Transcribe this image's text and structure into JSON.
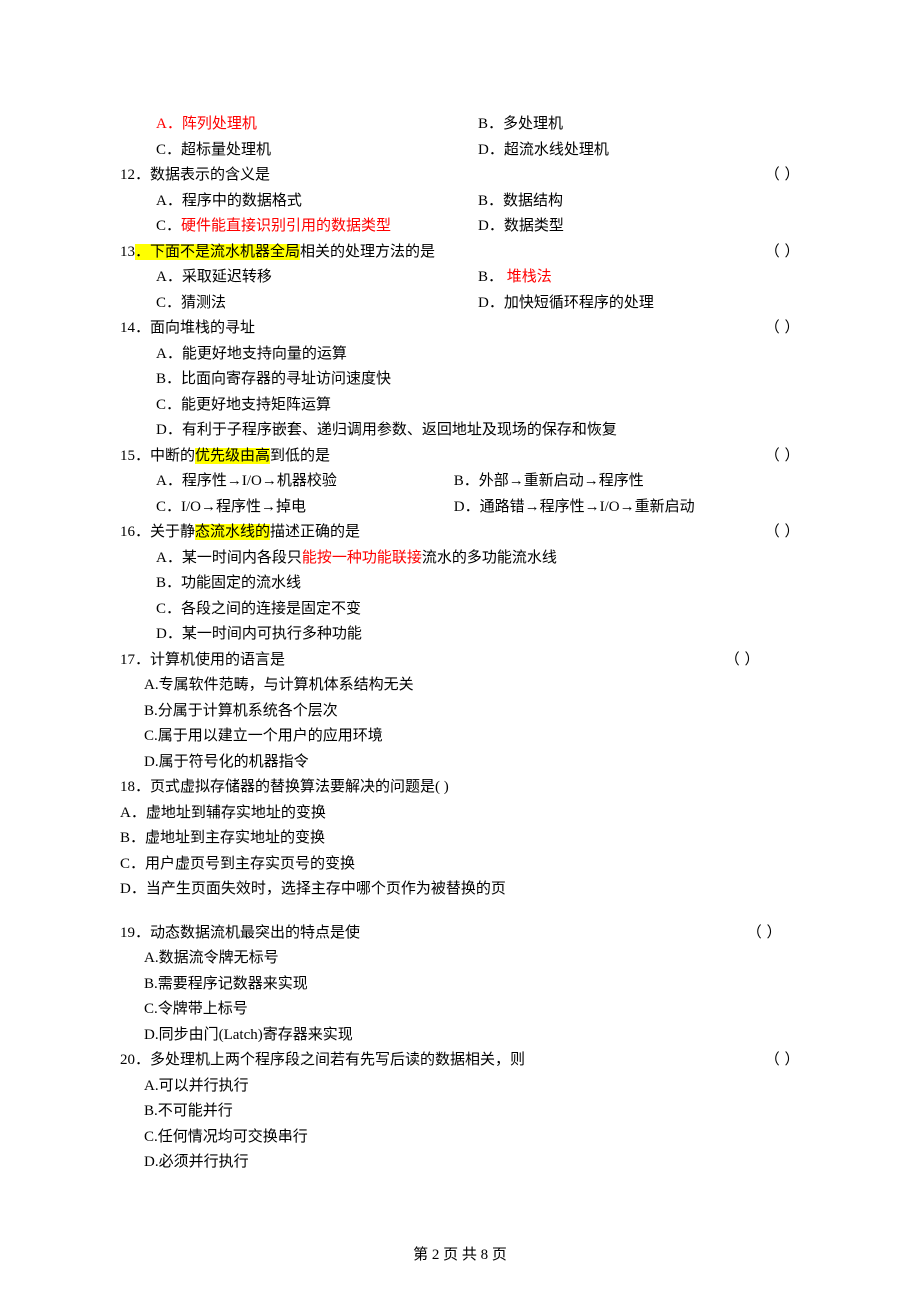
{
  "q11_opts": {
    "a": "A．阵列处理机",
    "b": "B．多处理机",
    "c": "C．超标量处理机",
    "d": "D．超流水线处理机"
  },
  "q12": {
    "stem_pre": "12．数据表示的含义是",
    "blank": "（         ）",
    "a": "A．程序中的数据格式",
    "b": "B．数据结构",
    "c_pre": "C．",
    "c_red": "硬件能直接识别引用的数据类型",
    "d": "D．数据类型"
  },
  "q13": {
    "num_pre": "13",
    "stem_hl": "．下面不是流水机器全局",
    "stem_post": "相关的处理方法的是",
    "blank": "（         ）",
    "a": "A．采取延迟转移",
    "b_pre": "B．    ",
    "b_red": "堆栈法",
    "c": "C．猜测法",
    "d": "D．加快短循环程序的处理"
  },
  "q14": {
    "stem": "14．面向堆栈的寻址",
    "blank": "（         ）",
    "a": "A．能更好地支持向量的运算",
    "b": "B．比面向寄存器的寻址访问速度快",
    "c": "C．能更好地支持矩阵运算",
    "d": "D．有利于子程序嵌套、递归调用参数、返回地址及现场的保存和恢复"
  },
  "q15": {
    "stem_pre": "15．中断的",
    "stem_hl": "优先级由高",
    "stem_post": "到低的是",
    "blank": "（         ）",
    "a": "A．程序性→I/O→机器校验",
    "b": "B．外部→重新启动→程序性",
    "c": "C．I/O→程序性→掉电",
    "d": "D．通路错→程序性→I/O→重新启动"
  },
  "q16": {
    "stem_pre": "16．关于静",
    "stem_hl": "态流水线的",
    "stem_post": "描述正确的是",
    "blank": "（         ）",
    "a_pre": "A．某一时间内各段只",
    "a_red": "能按一种功能联接",
    "a_post": "流水的多功能流水线",
    "b": "B．功能固定的流水线",
    "c": "C．各段之间的连接是固定不变",
    "d": "D．某一时间内可执行多种功能"
  },
  "q17": {
    "stem": "17．计算机使用的语言是",
    "blank": "（         ）",
    "a": "A.专属软件范畴，与计算机体系结构无关",
    "b": "B.分属于计算机系统各个层次",
    "c": "C.属于用以建立一个用户的应用环境",
    "d": "D.属于符号化的机器指令"
  },
  "q18": {
    "stem": "18．页式虚拟存储器的替换算法要解决的问题是(          )",
    "a": "A．虚地址到辅存实地址的变换",
    "b": "B．虚地址到主存实地址的变换",
    "c": "C．用户虚页号到主存实页号的变换",
    "d": "D．当产生页面失效时，选择主存中哪个页作为被替换的页"
  },
  "q19": {
    "stem": "19．动态数据流机最突出的特点是使",
    "blank": "（         ）",
    "a": "A.数据流令牌无标号",
    "b": "B.需要程序记数器来实现",
    "c": "C.令牌带上标号",
    "d": "D.同步由门(Latch)寄存器来实现"
  },
  "q20": {
    "stem": "20．多处理机上两个程序段之间若有先写后读的数据相关，则",
    "blank": "（         ）",
    "a": "A.可以并行执行",
    "b": "B.不可能并行",
    "c": "C.任何情况均可交换串行",
    "d": "D.必须并行执行"
  },
  "footer": "第 2 页 共 8 页"
}
